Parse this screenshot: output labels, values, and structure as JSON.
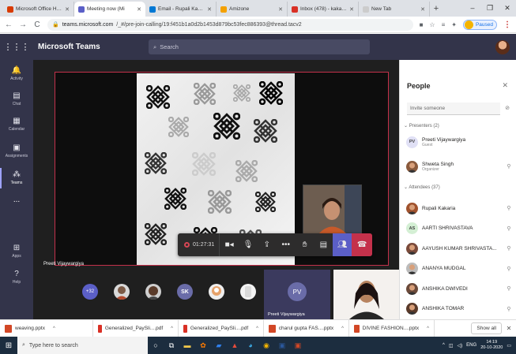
{
  "browser": {
    "tabs": [
      {
        "title": "Microsoft Office Hom",
        "color": "#d83b01",
        "active": false
      },
      {
        "title": "Meeting now (Mi",
        "color": "#5b5fc7",
        "active": true
      },
      {
        "title": "Email - Rupali Kakaria",
        "color": "#0078d4",
        "active": false
      },
      {
        "title": "Amizone",
        "color": "#f4a100",
        "active": false
      },
      {
        "title": "Inbox (478) - kakaria",
        "color": "#d93025",
        "active": false
      },
      {
        "title": "New Tab",
        "color": "#cccccc",
        "active": false
      }
    ],
    "url_host": "teams.microsoft.com",
    "url_path": "/_#/pre-join-calling/19:f451b1a0d2b1453d879bc53fec886393@thread.tacv2",
    "profile_label": "Paused"
  },
  "teams": {
    "app_title": "Microsoft Teams",
    "search_placeholder": "Search",
    "rail": [
      {
        "label": "Activity",
        "icon": "bell-icon",
        "glyph": "🔔"
      },
      {
        "label": "Chat",
        "icon": "chat-icon",
        "glyph": "▤"
      },
      {
        "label": "Calendar",
        "icon": "calendar-icon",
        "glyph": "▦"
      },
      {
        "label": "Assignments",
        "icon": "assignments-icon",
        "glyph": "▣"
      },
      {
        "label": "Teams",
        "icon": "teams-icon",
        "glyph": "⁂"
      },
      {
        "label": "...",
        "icon": "more-icon",
        "glyph": ""
      },
      {
        "label": "Apps",
        "icon": "apps-icon",
        "glyph": "⊞"
      },
      {
        "label": "Help",
        "icon": "help-icon",
        "glyph": "?"
      }
    ]
  },
  "meeting": {
    "presenter": "Preeti Vijaywargiya",
    "timer": "01:27:31",
    "more_participants": "+32",
    "gallery_initials": "SK",
    "tile_initials": "PV",
    "tile_name": "Preeti Vijaywargiya"
  },
  "people": {
    "title": "People",
    "invite_placeholder": "Invite someone",
    "presenters_header": "Presenters (2)",
    "attendees_header": "Attendees (37)",
    "presenters": [
      {
        "name": "Preeti Vijaywargiya",
        "role": "Guest",
        "initials": "PV",
        "color": "#e0e0f5",
        "photo": false
      },
      {
        "name": "Shweta Singh",
        "role": "Organizer",
        "initials": "",
        "color": "#8a5a3c",
        "photo": true
      }
    ],
    "attendees": [
      {
        "name": "Rupali Kakaria",
        "initials": "",
        "color": "#a0522d",
        "photo": true
      },
      {
        "name": "AARTI SHRIVASTAVA",
        "initials": "AS",
        "color": "#d4efd4",
        "photo": false
      },
      {
        "name": "AAYUSH KUMAR SHRIVASTA...",
        "initials": "",
        "color": "#7a4a3a",
        "photo": true
      },
      {
        "name": "ANANYA MUDGAL",
        "initials": "",
        "color": "#bbbbbb",
        "photo": true
      },
      {
        "name": "ANSHIKA DWIVEDI",
        "initials": "",
        "color": "#6b4a3a",
        "photo": true
      },
      {
        "name": "ANSHIKA TOMAR",
        "initials": "",
        "color": "#5a3a2a",
        "photo": true
      }
    ]
  },
  "downloads": {
    "items": [
      {
        "name": "weaving.pptx",
        "color": "#d24726"
      },
      {
        "name": "Generalized_PaySli....pdf",
        "color": "#d93025"
      },
      {
        "name": "Generalized_PaySli....pdf",
        "color": "#d93025"
      },
      {
        "name": "charul gupta FAS....pptx",
        "color": "#d24726"
      },
      {
        "name": "DIVINE FASHION....pptx",
        "color": "#d24726"
      }
    ],
    "show_all": "Show all"
  },
  "taskbar": {
    "search_placeholder": "Type here to search",
    "lang": "ENG",
    "time": "14:19",
    "date": "20-10-2020"
  }
}
